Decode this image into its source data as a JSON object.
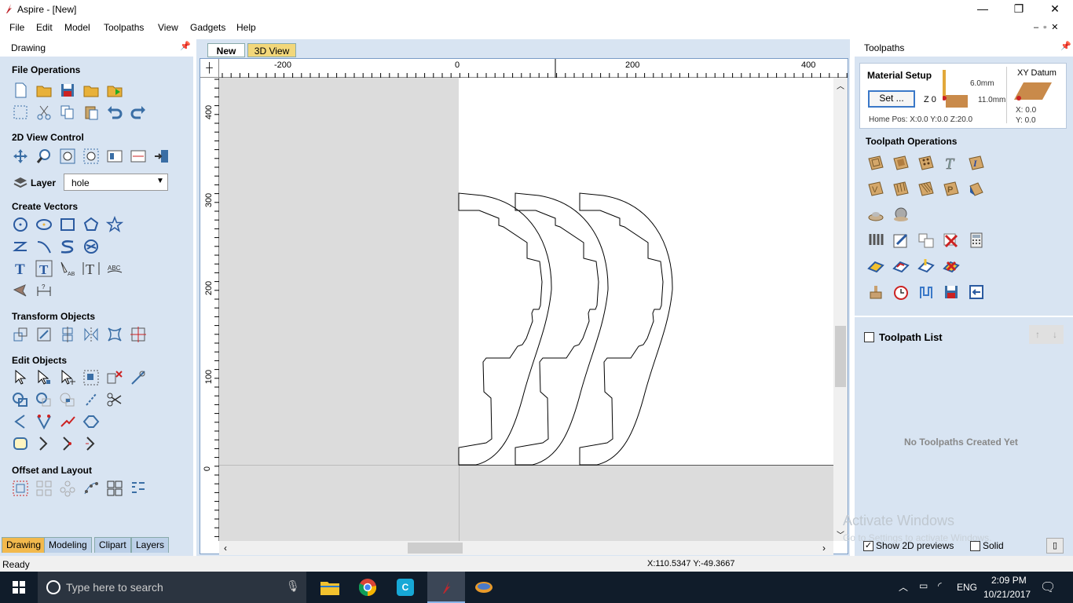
{
  "window": {
    "title": "Aspire - [New]",
    "minimize": "—",
    "maximize": "❐",
    "close": "✕"
  },
  "menu": [
    "File",
    "Edit",
    "Model",
    "Toolpaths",
    "View",
    "Gadgets",
    "Help"
  ],
  "left_panel": {
    "title": "Drawing",
    "sections": {
      "file_ops": "File Operations",
      "view_control": "2D View Control",
      "layer_label": "Layer",
      "layer_value": "hole",
      "create_vectors": "Create Vectors",
      "transform": "Transform Objects",
      "edit": "Edit Objects",
      "offset": "Offset and Layout"
    },
    "bottom_tabs": [
      "Drawing",
      "Modeling",
      "Clipart",
      "Layers"
    ]
  },
  "view": {
    "tabs": [
      "New",
      "3D View"
    ],
    "ruler_x": [
      "-200",
      "0",
      "200",
      "400"
    ],
    "ruler_y": [
      "400",
      "300",
      "200",
      "100",
      "0"
    ]
  },
  "right_panel": {
    "title": "Toolpaths",
    "material_setup": "Material Setup",
    "set_button": "Set ...",
    "z0": "Z 0",
    "dim_top": "6.0mm",
    "dim_bottom": "11.0mm",
    "home_pos": "Home Pos:  X:0.0 Y:0.0 Z:20.0",
    "xy_datum": "XY Datum",
    "x_val": "X: 0.0",
    "y_val": "Y: 0.0",
    "toolpath_ops": "Toolpath Operations",
    "toolpath_list": "Toolpath List",
    "no_toolpaths": "No Toolpaths Created Yet",
    "show_2d": "Show 2D previews",
    "solid": "Solid",
    "watermark1": "Activate Windows",
    "watermark2": "Go to Settings to activate Windows."
  },
  "status": {
    "left": "Ready",
    "coords": "X:110.5347 Y:-49.3667"
  },
  "taskbar": {
    "search": "Type here to search",
    "lang": "ENG",
    "time": "2:09 PM",
    "date": "10/21/2017"
  }
}
